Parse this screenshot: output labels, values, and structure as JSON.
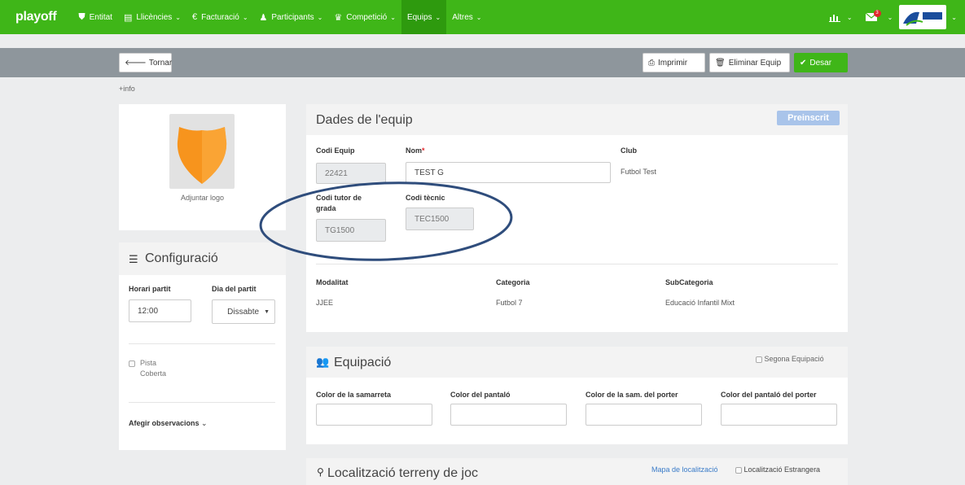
{
  "nav": {
    "brand": "playoff",
    "items": [
      {
        "icon": "shield-icon",
        "glyph": "⛨",
        "label": "Entitat",
        "dropdown": false
      },
      {
        "icon": "id-card-icon",
        "glyph": "▤",
        "label": "Llicències",
        "dropdown": true
      },
      {
        "icon": "euro-icon",
        "glyph": "€",
        "label": "Facturació",
        "dropdown": true
      },
      {
        "icon": "user-icon",
        "glyph": "♟",
        "label": "Participants",
        "dropdown": true
      },
      {
        "icon": "trophy-icon",
        "glyph": "🏆",
        "label": "Competició",
        "dropdown": true
      },
      {
        "icon": "",
        "glyph": "",
        "label": "Equips",
        "dropdown": true
      },
      {
        "icon": "",
        "glyph": "",
        "label": "Altres",
        "dropdown": true
      }
    ],
    "notification_count": "3",
    "org_logo_text": "CONSELL ESPORTIU"
  },
  "toolbar": {
    "back_label": "Tornar",
    "print_label": "Imprimir",
    "delete_label": "Eliminar Equip",
    "save_label": "Desar"
  },
  "info_link": "+info",
  "logo_card": {
    "attach_label": "Adjuntar logo"
  },
  "config": {
    "title": "Configuració",
    "time_label": "Horari partit",
    "time_value": "12:00",
    "day_label": "Dia del partit",
    "day_value": "Dissabte",
    "covered_label_1": "Pista",
    "covered_label_2": "Coberta",
    "observations_label": "Afegir observacions"
  },
  "team": {
    "title": "Dades de l'equip",
    "status_badge": "Preinscrit",
    "code_label": "Codi Equip",
    "code_value": "22421",
    "name_label": "Nom",
    "required_mark": "*",
    "name_value": "TEST G",
    "club_label": "Club",
    "club_value": "Futbol Test",
    "tutor_label_1": "Codi tutor de",
    "tutor_label_2": "grada",
    "tutor_value": "TG1500",
    "tech_label": "Codi tècnic",
    "tech_value": "TEC1500",
    "modality_label": "Modalitat",
    "modality_value": "JJEE",
    "category_label": "Categoria",
    "category_value": "Futbol 7",
    "subcategory_label": "SubCategoria",
    "subcategory_value": "Educació Infantil Mixt"
  },
  "kit": {
    "title": "Equipació",
    "second_kit_label": "Segona Equipació",
    "shirt_label": "Color de la samarreta",
    "shorts_label": "Color del pantaló",
    "gk_shirt_label": "Color de la sam. del porter",
    "gk_shorts_label": "Color del pantaló del porter"
  },
  "location": {
    "title": "Localització terreny de joc",
    "map_link": "Mapa de localització",
    "foreign_label": "Localització Estrangera"
  },
  "colors": {
    "nav_green": "#3fb618",
    "badge_blue": "#a9c4ea",
    "annotation_ellipse": "#2f4d7c",
    "shield_orange": "#f7941d"
  }
}
